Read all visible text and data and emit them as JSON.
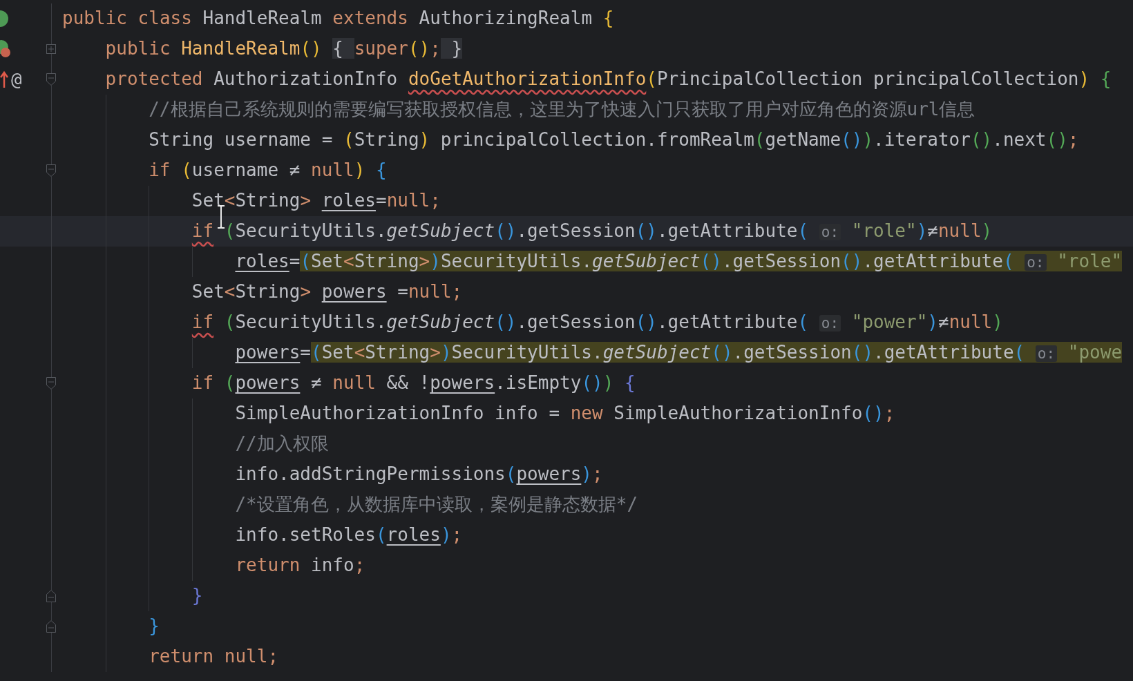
{
  "editor": {
    "lines": [
      {
        "current": false,
        "gutter_icons": [
          {
            "kind": "class"
          }
        ],
        "tokens": [
          {
            "kind": "kw",
            "text": "public class "
          },
          {
            "kind": "txt",
            "text": "HandleRealm "
          },
          {
            "kind": "kw",
            "text": "extends "
          },
          {
            "kind": "txt",
            "text": "AuthorizingRealm "
          },
          {
            "kind": "pg",
            "text": "{"
          }
        ],
        "children": [
          {
            "current": false,
            "gutter_icons": [
              {
                "kind": "method"
              }
            ],
            "fold_marker": {
              "kind": "collapsed"
            },
            "tokens": [
              {
                "kind": "kw",
                "text": "public "
              },
              {
                "kind": "decl",
                "text": "HandleRealm"
              },
              {
                "kind": "pg",
                "text": "() "
              },
              {
                "kind": "fold",
                "text": "{ "
              },
              {
                "kind": "kw",
                "text": "super"
              },
              {
                "kind": "pg",
                "text": "()"
              },
              {
                "kind": "kw",
                "text": ";"
              },
              {
                "kind": "fold",
                "text": " }"
              }
            ]
          },
          {
            "current": false,
            "gutter_icons": [
              {
                "kind": "arrow"
              },
              {
                "kind": "annotation",
                "text": "@"
              }
            ],
            "fold_marker": {
              "kind": "start"
            },
            "tokens": [
              {
                "kind": "kw",
                "text": "protected "
              },
              {
                "kind": "txt",
                "text": "AuthorizationInfo "
              },
              {
                "kind": "decl-warn",
                "text": "doGetAuthorizationInfo"
              },
              {
                "kind": "pg",
                "text": "("
              },
              {
                "kind": "txt",
                "text": "PrincipalCollection principalCollection"
              },
              {
                "kind": "pg",
                "text": ") "
              },
              {
                "kind": "pn",
                "text": "{"
              }
            ],
            "children": [
              {
                "current": false,
                "tokens": [
                  {
                    "kind": "cmt",
                    "text": "//根据自己系统规则的需要编写获取授权信息，这里为了快速入门只获取了用户对应角色的资源url信息"
                  }
                ]
              },
              {
                "current": false,
                "tokens": [
                  {
                    "kind": "txt",
                    "text": "String username = "
                  },
                  {
                    "kind": "pg",
                    "text": "("
                  },
                  {
                    "kind": "txt",
                    "text": "String"
                  },
                  {
                    "kind": "pg",
                    "text": ")"
                  },
                  {
                    "kind": "txt",
                    "text": " principalCollection.fromRealm"
                  },
                  {
                    "kind": "pn",
                    "text": "("
                  },
                  {
                    "kind": "txt",
                    "text": "getName"
                  },
                  {
                    "kind": "pb",
                    "text": "()"
                  },
                  {
                    "kind": "pn",
                    "text": ")"
                  },
                  {
                    "kind": "txt",
                    "text": ".iterator"
                  },
                  {
                    "kind": "pn",
                    "text": "()"
                  },
                  {
                    "kind": "txt",
                    "text": ".next"
                  },
                  {
                    "kind": "pn",
                    "text": "()"
                  },
                  {
                    "kind": "kw",
                    "text": ";"
                  }
                ]
              },
              {
                "current": false,
                "fold_marker": {
                  "kind": "start"
                },
                "tokens": [
                  {
                    "kind": "kw",
                    "text": "if "
                  },
                  {
                    "kind": "pg",
                    "text": "("
                  },
                  {
                    "kind": "txt",
                    "text": "username ≠ "
                  },
                  {
                    "kind": "kw",
                    "text": "null"
                  },
                  {
                    "kind": "pg",
                    "text": ") "
                  },
                  {
                    "kind": "pb",
                    "text": "{"
                  }
                ],
                "children": [
                  {
                    "current": false,
                    "tokens": [
                      {
                        "kind": "txt",
                        "text": "Set"
                      },
                      {
                        "kind": "kw",
                        "text": "<"
                      },
                      {
                        "kind": "txt",
                        "text": "String"
                      },
                      {
                        "kind": "kw",
                        "text": "> "
                      },
                      {
                        "kind": "var",
                        "text": "roles"
                      },
                      {
                        "kind": "txt",
                        "text": "="
                      },
                      {
                        "kind": "kw",
                        "text": "null;"
                      }
                    ]
                  },
                  {
                    "current": true,
                    "tokens": [
                      {
                        "kind": "kw-warn",
                        "text": "if"
                      },
                      {
                        "kind": "cursor"
                      },
                      {
                        "kind": "pn",
                        "text": " ("
                      },
                      {
                        "kind": "txt",
                        "text": "SecurityUtils."
                      },
                      {
                        "kind": "it",
                        "text": "getSubject"
                      },
                      {
                        "kind": "pb",
                        "text": "()"
                      },
                      {
                        "kind": "txt",
                        "text": ".getSession"
                      },
                      {
                        "kind": "pb",
                        "text": "()"
                      },
                      {
                        "kind": "txt",
                        "text": ".getAttribute"
                      },
                      {
                        "kind": "pb",
                        "text": "( "
                      },
                      {
                        "kind": "hint",
                        "text": "o:"
                      },
                      {
                        "kind": "str",
                        "text": " \"role\""
                      },
                      {
                        "kind": "pb",
                        "text": ")"
                      },
                      {
                        "kind": "txt",
                        "text": "≠"
                      },
                      {
                        "kind": "kw",
                        "text": "null"
                      },
                      {
                        "kind": "pn",
                        "text": ")"
                      }
                    ],
                    "children": [
                      {
                        "current": false,
                        "tokens": [
                          {
                            "kind": "var",
                            "text": "roles"
                          },
                          {
                            "kind": "txt",
                            "text": "="
                          }
                        ],
                        "highlighted_tokens": [
                          {
                            "kind": "pb",
                            "text": "("
                          },
                          {
                            "kind": "txt",
                            "text": "Set"
                          },
                          {
                            "kind": "kw",
                            "text": "<"
                          },
                          {
                            "kind": "txt",
                            "text": "String"
                          },
                          {
                            "kind": "kw",
                            "text": ">"
                          },
                          {
                            "kind": "pb",
                            "text": ")"
                          },
                          {
                            "kind": "txt",
                            "text": "SecurityUtils."
                          },
                          {
                            "kind": "it",
                            "text": "getSubject"
                          },
                          {
                            "kind": "pb",
                            "text": "()"
                          },
                          {
                            "kind": "txt",
                            "text": ".getSession"
                          },
                          {
                            "kind": "pb",
                            "text": "()"
                          },
                          {
                            "kind": "txt",
                            "text": ".getAttribute"
                          },
                          {
                            "kind": "pb",
                            "text": "( "
                          },
                          {
                            "kind": "hint",
                            "text": "o:"
                          },
                          {
                            "kind": "str",
                            "text": " \"role\""
                          }
                        ]
                      }
                    ]
                  },
                  {
                    "current": false,
                    "tokens": [
                      {
                        "kind": "txt",
                        "text": "Set"
                      },
                      {
                        "kind": "kw",
                        "text": "<"
                      },
                      {
                        "kind": "txt",
                        "text": "String"
                      },
                      {
                        "kind": "kw",
                        "text": "> "
                      },
                      {
                        "kind": "var",
                        "text": "powers"
                      },
                      {
                        "kind": "txt",
                        "text": " ="
                      },
                      {
                        "kind": "kw",
                        "text": "null;"
                      }
                    ]
                  },
                  {
                    "current": false,
                    "tokens": [
                      {
                        "kind": "kw-warn",
                        "text": "if"
                      },
                      {
                        "kind": "pn",
                        "text": " ("
                      },
                      {
                        "kind": "txt",
                        "text": "SecurityUtils."
                      },
                      {
                        "kind": "it",
                        "text": "getSubject"
                      },
                      {
                        "kind": "pb",
                        "text": "()"
                      },
                      {
                        "kind": "txt",
                        "text": ".getSession"
                      },
                      {
                        "kind": "pb",
                        "text": "()"
                      },
                      {
                        "kind": "txt",
                        "text": ".getAttribute"
                      },
                      {
                        "kind": "pb",
                        "text": "( "
                      },
                      {
                        "kind": "hint",
                        "text": "o:"
                      },
                      {
                        "kind": "str",
                        "text": " \"power\""
                      },
                      {
                        "kind": "pb",
                        "text": ")"
                      },
                      {
                        "kind": "txt",
                        "text": "≠"
                      },
                      {
                        "kind": "kw",
                        "text": "null"
                      },
                      {
                        "kind": "pn",
                        "text": ")"
                      }
                    ],
                    "children": [
                      {
                        "current": false,
                        "tokens": [
                          {
                            "kind": "var",
                            "text": "powers"
                          },
                          {
                            "kind": "txt",
                            "text": "="
                          }
                        ],
                        "highlighted_tokens": [
                          {
                            "kind": "pb",
                            "text": "("
                          },
                          {
                            "kind": "txt",
                            "text": "Set"
                          },
                          {
                            "kind": "kw",
                            "text": "<"
                          },
                          {
                            "kind": "txt",
                            "text": "String"
                          },
                          {
                            "kind": "kw",
                            "text": ">"
                          },
                          {
                            "kind": "pb",
                            "text": ")"
                          },
                          {
                            "kind": "txt",
                            "text": "SecurityUtils."
                          },
                          {
                            "kind": "it",
                            "text": "getSubject"
                          },
                          {
                            "kind": "pb",
                            "text": "()"
                          },
                          {
                            "kind": "txt",
                            "text": ".getSession"
                          },
                          {
                            "kind": "pb",
                            "text": "()"
                          },
                          {
                            "kind": "txt",
                            "text": ".getAttribute"
                          },
                          {
                            "kind": "pb",
                            "text": "( "
                          },
                          {
                            "kind": "hint",
                            "text": "o:"
                          },
                          {
                            "kind": "str",
                            "text": " \"powe"
                          }
                        ]
                      }
                    ]
                  },
                  {
                    "current": false,
                    "fold_marker": {
                      "kind": "start"
                    },
                    "tokens": [
                      {
                        "kind": "kw",
                        "text": "if "
                      },
                      {
                        "kind": "pn",
                        "text": "("
                      },
                      {
                        "kind": "var",
                        "text": "powers"
                      },
                      {
                        "kind": "txt",
                        "text": " ≠ "
                      },
                      {
                        "kind": "kw",
                        "text": "null"
                      },
                      {
                        "kind": "txt",
                        "text": " && !"
                      },
                      {
                        "kind": "var",
                        "text": "powers"
                      },
                      {
                        "kind": "txt",
                        "text": ".isEmpty"
                      },
                      {
                        "kind": "pb",
                        "text": "()"
                      },
                      {
                        "kind": "pn",
                        "text": ") "
                      },
                      {
                        "kind": "pp",
                        "text": "{"
                      }
                    ],
                    "children": [
                      {
                        "current": false,
                        "tokens": [
                          {
                            "kind": "txt",
                            "text": "SimpleAuthorizationInfo info = "
                          },
                          {
                            "kind": "kw",
                            "text": "new "
                          },
                          {
                            "kind": "txt",
                            "text": "SimpleAuthorizationInfo"
                          },
                          {
                            "kind": "pb",
                            "text": "()"
                          },
                          {
                            "kind": "kw",
                            "text": ";"
                          }
                        ]
                      },
                      {
                        "current": false,
                        "tokens": [
                          {
                            "kind": "cmt",
                            "text": "//加入权限"
                          }
                        ]
                      },
                      {
                        "current": false,
                        "tokens": [
                          {
                            "kind": "txt",
                            "text": "info.addStringPermissions"
                          },
                          {
                            "kind": "pb",
                            "text": "("
                          },
                          {
                            "kind": "var",
                            "text": "powers"
                          },
                          {
                            "kind": "pb",
                            "text": ")"
                          },
                          {
                            "kind": "kw",
                            "text": ";"
                          }
                        ]
                      },
                      {
                        "current": false,
                        "tokens": [
                          {
                            "kind": "cmt",
                            "text": "/*设置角色，从数据库中读取，案例是静态数据*/"
                          }
                        ]
                      },
                      {
                        "current": false,
                        "tokens": [
                          {
                            "kind": "txt",
                            "text": "info.setRoles"
                          },
                          {
                            "kind": "pb",
                            "text": "("
                          },
                          {
                            "kind": "var",
                            "text": "roles"
                          },
                          {
                            "kind": "pb",
                            "text": ")"
                          },
                          {
                            "kind": "kw",
                            "text": ";"
                          }
                        ]
                      },
                      {
                        "current": false,
                        "tokens": [
                          {
                            "kind": "kw",
                            "text": "return "
                          },
                          {
                            "kind": "txt",
                            "text": "info"
                          },
                          {
                            "kind": "kw",
                            "text": ";"
                          }
                        ]
                      }
                    ]
                  },
                  {
                    "current": false,
                    "fold_marker": {
                      "kind": "end"
                    },
                    "tokens": [
                      {
                        "kind": "pp",
                        "text": "}"
                      }
                    ]
                  }
                ]
              },
              {
                "current": false,
                "fold_marker": {
                  "kind": "end"
                },
                "tokens": [
                  {
                    "kind": "pb",
                    "text": "}"
                  }
                ]
              },
              {
                "current": false,
                "tokens": [
                  {
                    "kind": "kw",
                    "text": "return null;"
                  }
                ]
              }
            ]
          }
        ]
      }
    ]
  }
}
